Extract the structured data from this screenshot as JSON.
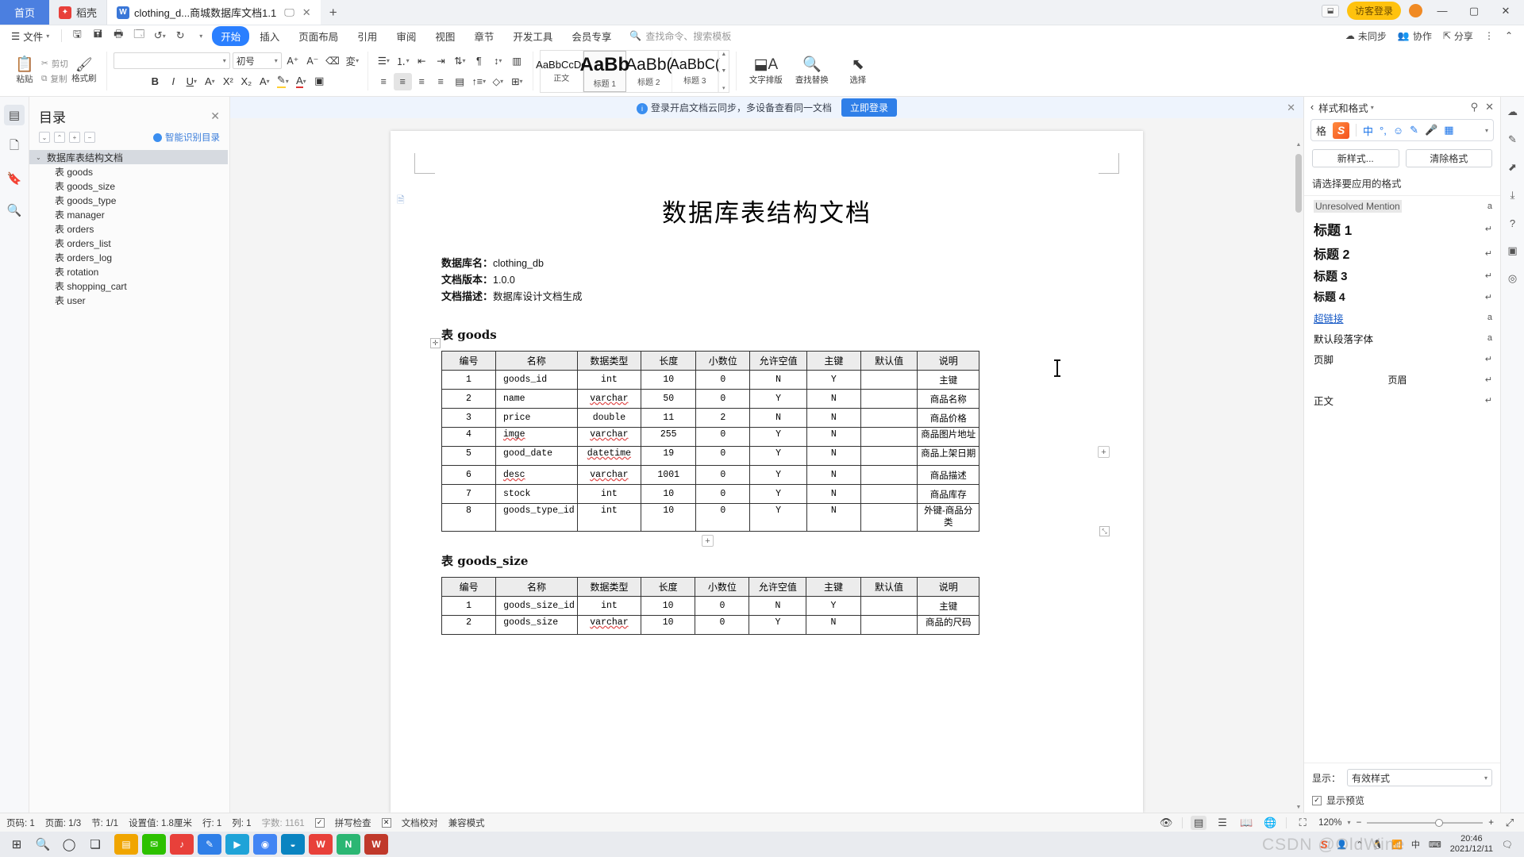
{
  "window": {
    "tabs": [
      {
        "label": "首页",
        "kind": "home"
      },
      {
        "label": "稻壳",
        "kind": "dock",
        "icon": "flame-icon"
      },
      {
        "label": "clothing_d...商城数据库文档1.1",
        "kind": "doc",
        "icon": "wps-writer-icon"
      }
    ],
    "new_tab_label": "+",
    "login_label": "访客登录",
    "minimize": "—",
    "maximize": "▢",
    "close": "✕"
  },
  "menu": {
    "file_label": "文件",
    "quick_icons": [
      "save-icon",
      "save-as-icon",
      "print-icon",
      "print-preview-icon",
      "undo-icon",
      "redo-icon",
      "customize-icon"
    ],
    "items": [
      "开始",
      "插入",
      "页面布局",
      "引用",
      "审阅",
      "视图",
      "章节",
      "开发工具",
      "会员专享"
    ],
    "selected": "开始",
    "search_placeholder": "查找命令、搜索模板",
    "right_items": [
      "未同步",
      "协作",
      "分享"
    ]
  },
  "ribbon": {
    "paste_label": "粘贴",
    "cut_label": "剪切",
    "copy_label": "复制",
    "format_brush_label": "格式刷",
    "font_name": "",
    "font_size": "初号",
    "styles": [
      {
        "sample": "AaBbCcDd",
        "label": "正文",
        "size": 12,
        "selected": false
      },
      {
        "sample": "AaBb",
        "label": "标题 1",
        "size": 25,
        "selected": true
      },
      {
        "sample": "AaBb(",
        "label": "标题 2",
        "size": 21,
        "selected": false
      },
      {
        "sample": "AaBbC(",
        "label": "标题 3",
        "size": 18,
        "selected": false
      }
    ],
    "text_layout_label": "文字排版",
    "find_replace_label": "查找替换",
    "select_label": "选择"
  },
  "outline": {
    "title": "目录",
    "smart_label": "智能识别目录",
    "tools": [
      "collapse-down-icon",
      "collapse-up-icon",
      "expand-all-icon",
      "collapse-all-icon"
    ],
    "items": [
      {
        "label": "数据库表结构文档",
        "level": 0,
        "selected": true
      },
      {
        "label": "表 goods",
        "level": 1,
        "selected": false
      },
      {
        "label": "表 goods_size",
        "level": 1,
        "selected": false
      },
      {
        "label": "表 goods_type",
        "level": 1,
        "selected": false
      },
      {
        "label": "表 manager",
        "level": 1,
        "selected": false
      },
      {
        "label": "表 orders",
        "level": 1,
        "selected": false
      },
      {
        "label": "表 orders_list",
        "level": 1,
        "selected": false
      },
      {
        "label": "表 orders_log",
        "level": 1,
        "selected": false
      },
      {
        "label": "表 rotation",
        "level": 1,
        "selected": false
      },
      {
        "label": "表 shopping_cart",
        "level": 1,
        "selected": false
      },
      {
        "label": "表 user",
        "level": 1,
        "selected": false
      }
    ]
  },
  "notification": {
    "text": "登录开启文档云同步，多设备查看同一文档",
    "button": "立即登录",
    "close": "✕"
  },
  "document": {
    "title": "数据库表结构文档",
    "meta": [
      {
        "key": "数据库名：",
        "value": "clothing_db"
      },
      {
        "key": "文档版本：",
        "value": "1.0.0"
      },
      {
        "key": "文档描述：",
        "value": "数据库设计文档生成"
      }
    ],
    "sections": [
      {
        "heading": "表 goods",
        "columns": [
          "编号",
          "名称",
          "数据类型",
          "长度",
          "小数位",
          "允许空值",
          "主键",
          "默认值",
          "说明"
        ],
        "rows": [
          [
            "1",
            "goods_id",
            "int",
            "10",
            "0",
            "N",
            "Y",
            "",
            "主键"
          ],
          [
            "2",
            "name",
            "varchar",
            "50",
            "0",
            "Y",
            "N",
            "",
            "商品名称"
          ],
          [
            "3",
            "price",
            "double",
            "11",
            "2",
            "N",
            "N",
            "",
            "商品价格"
          ],
          [
            "4",
            "imge",
            "varchar",
            "255",
            "0",
            "Y",
            "N",
            "",
            "商品图片地址"
          ],
          [
            "5",
            "good_date",
            "datetime",
            "19",
            "0",
            "Y",
            "N",
            "",
            "商品上架日期"
          ],
          [
            "6",
            "desc",
            "varchar",
            "1001",
            "0",
            "Y",
            "N",
            "",
            "商品描述"
          ],
          [
            "7",
            "stock",
            "int",
            "10",
            "0",
            "Y",
            "N",
            "",
            "商品库存"
          ],
          [
            "8",
            "goods_type_id",
            "int",
            "10",
            "0",
            "Y",
            "N",
            "",
            "外键-商品分类"
          ]
        ]
      },
      {
        "heading": "表 goods_size",
        "columns": [
          "编号",
          "名称",
          "数据类型",
          "长度",
          "小数位",
          "允许空值",
          "主键",
          "默认值",
          "说明"
        ],
        "rows": [
          [
            "1",
            "goods_size_id",
            "int",
            "10",
            "0",
            "N",
            "Y",
            "",
            "主键"
          ],
          [
            "2",
            "goods_size",
            "varchar",
            "10",
            "0",
            "Y",
            "N",
            "",
            "商品的尺码"
          ]
        ]
      }
    ]
  },
  "styles_panel": {
    "title": "样式和格式",
    "pin_icon": "pin-icon",
    "close_icon": "close-icon",
    "sogou_icons": [
      "chinese-mode-icon",
      "punctuation-icon",
      "emoji-icon",
      "handwriting-icon",
      "voice-icon",
      "toolbox-icon"
    ],
    "new_style_label": "新样式...",
    "clear_format_label": "清除格式",
    "prompt": "请选择要应用的格式",
    "items": [
      {
        "name": "Unresolved Mention",
        "kind": "unres",
        "mark": "a"
      },
      {
        "name": "标题 1",
        "kind": "h1",
        "mark": "↵"
      },
      {
        "name": "标题 2",
        "kind": "h2",
        "mark": "↵"
      },
      {
        "name": "标题 3",
        "kind": "h3",
        "mark": "↵"
      },
      {
        "name": "标题 4",
        "kind": "h4",
        "mark": "↵"
      },
      {
        "name": "超链接",
        "kind": "link",
        "mark": "a"
      },
      {
        "name": "默认段落字体",
        "kind": "plain",
        "mark": "a"
      },
      {
        "name": "页脚",
        "kind": "plain",
        "mark": "↵"
      },
      {
        "name": "页眉",
        "kind": "ctr",
        "mark": "↵"
      },
      {
        "name": "正文",
        "kind": "plain",
        "mark": "↵"
      }
    ],
    "show_label": "显示：",
    "show_value": "有效样式",
    "preview_label": "显示预览",
    "preview_checked": true
  },
  "statusbar": {
    "page_no": "页码: 1",
    "page_of": "页面: 1/3",
    "section": "节: 1/1",
    "setting": "设置值: 1.8厘米",
    "row": "行: 1",
    "col": "列: 1",
    "word_count": "字数: 1161",
    "spell_check": "拼写检查",
    "doc_proof": "文档校对",
    "compat_mode": "兼容模式",
    "view_icons": [
      "eye-icon",
      "page-view-icon",
      "outline-view-icon",
      "book-view-icon",
      "web-view-icon",
      "fit-page-icon"
    ],
    "zoom": "120%",
    "zoom_minus": "−",
    "zoom_plus": "+",
    "fullscreen": "⤢"
  },
  "taskbar": {
    "start_icon": "windows-start-icon",
    "search_icon": "search-icon",
    "cortana_icon": "cortana-icon",
    "taskview_icon": "task-view-icon",
    "apps": [
      {
        "name": "file-explorer",
        "color": "#f0a500",
        "glyph": "▤"
      },
      {
        "name": "wechat",
        "color": "#2dc100",
        "glyph": "✉"
      },
      {
        "name": "music-player",
        "color": "#e8403a",
        "glyph": "♪"
      },
      {
        "name": "editor-app",
        "color": "#2f7fe8",
        "glyph": "✎"
      },
      {
        "name": "media-app",
        "color": "#1fa3d8",
        "glyph": "▶"
      },
      {
        "name": "chrome",
        "color": "#4285f4",
        "glyph": "◉"
      },
      {
        "name": "edge",
        "color": "#0a84c1",
        "glyph": "◒"
      },
      {
        "name": "wps-app",
        "color": "#e8403a",
        "glyph": "W"
      },
      {
        "name": "note-app",
        "color": "#2bb673",
        "glyph": "N"
      },
      {
        "name": "wps-writer",
        "color": "#c0392b",
        "glyph": "W"
      }
    ],
    "tray": [
      "sogou-icon",
      "people-icon",
      "chevron-up-icon",
      "qq-icon",
      "network-icon",
      "input-method-icon",
      "keyboard-icon"
    ],
    "time": "20:46",
    "date": "2021/12/11",
    "watermark": "CSDN @OldWine"
  },
  "colors": {
    "accent": "#2a7fff",
    "tab_home": "#4b7fe0",
    "login_pill": "#ffc20e",
    "notif_bg": "#eef4fd",
    "toc_selected": "#d6dae0"
  }
}
